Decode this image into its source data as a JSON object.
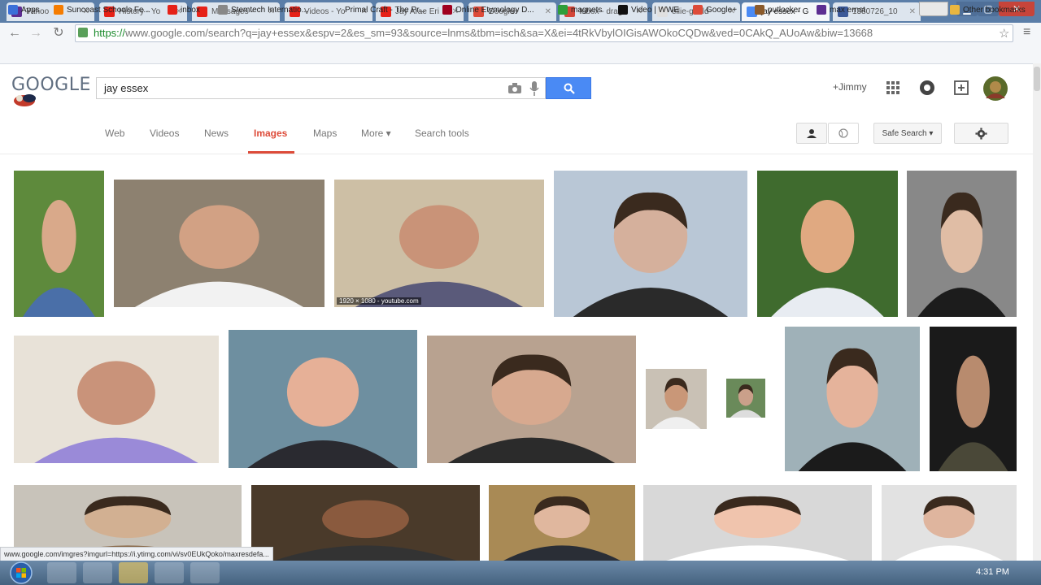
{
  "browser": {
    "tabs": [
      {
        "title": "Yahoo",
        "active": false,
        "icon": "yahoo-icon",
        "color": "#5c2d91"
      },
      {
        "title": "History - Yo",
        "active": false,
        "icon": "youtube-icon",
        "color": "#e62117"
      },
      {
        "title": "Messages -",
        "active": false,
        "icon": "youtube-icon",
        "color": "#e62117"
      },
      {
        "title": "Videos - Yo",
        "active": false,
        "icon": "youtube-icon",
        "color": "#e62117"
      },
      {
        "title": "Jay Arae Eri",
        "active": false,
        "icon": "youtube-icon",
        "color": "#e62117"
      },
      {
        "title": "Google+",
        "active": false,
        "icon": "google-plus-icon",
        "color": "#dd4b39"
      },
      {
        "title": "Inbox - drag",
        "active": false,
        "icon": "gmail-icon",
        "color": "#d44638"
      },
      {
        "title": "ellie-gould",
        "active": false,
        "icon": "document-icon",
        "color": "#e0e0e0"
      },
      {
        "title": "jay essex - G",
        "active": true,
        "icon": "google-icon",
        "color": "#4a8af4"
      },
      {
        "title": "1380726_10",
        "active": false,
        "icon": "facebook-icon",
        "color": "#3b5998"
      }
    ],
    "url_scheme": "https://",
    "url_rest": "www.google.com/search?q=jay+essex&espv=2&es_sm=93&source=lnms&tbm=isch&sa=X&ei=4tRkVbylOIGisAWOkoCQDw&ved=0CAkQ_AUoAw&biw=13668"
  },
  "bookmarks": [
    {
      "label": "Apps",
      "color": "#3a6fd8"
    },
    {
      "label": "Suncoast Schools Fe...",
      "color": "#f57c00"
    },
    {
      "label": "inbox",
      "color": "#e62117"
    },
    {
      "label": "Stemtech Internatio...",
      "color": "#888888"
    },
    {
      "label": "Primal Craft - The Pr...",
      "color": ""
    },
    {
      "label": "Online Etymology D...",
      "color": "#a0001e"
    },
    {
      "label": "magnets",
      "color": "#2e9e3a"
    },
    {
      "label": "Video | WWE",
      "color": "#111111"
    },
    {
      "label": "Google+",
      "color": "#dd4b39"
    },
    {
      "label": "putlocker",
      "color": "#8b5a2b"
    },
    {
      "label": "max ernst",
      "color": "#5c2d91"
    },
    {
      "label": "Other bookmarks",
      "color": "#e8b640"
    }
  ],
  "google": {
    "logo": "GOOGLE",
    "query": "jay essex",
    "user": "+Jimmy",
    "nav": [
      "Web",
      "Videos",
      "News",
      "Images",
      "Maps",
      "More ▾",
      "Search tools"
    ],
    "active_nav": "Images",
    "safesearch": "Safe Search ▾"
  },
  "results": [
    {
      "bg": "#5e8a3c",
      "skin": "#d9a98a",
      "shirt": "#4a6fa8",
      "bald": true
    },
    {
      "bg": "#8d8170",
      "skin": "#d2a184",
      "shirt": "#f2f2f2",
      "bald": true
    },
    {
      "bg": "#cdbfa5",
      "skin": "#c99378",
      "shirt": "#5a5a7a",
      "bald": true,
      "badge": "1920 × 1080 - youtube.com"
    },
    {
      "bg": "#b9c7d6",
      "skin": "#d5b09c",
      "shirt": "#2a2a2a",
      "bald": false
    },
    {
      "bg": "#3f6b2e",
      "skin": "#e0a981",
      "shirt": "#e8ecf2",
      "bald": true
    },
    {
      "bg": "#888888",
      "skin": "#e0bda5",
      "shirt": "#1c1c1c",
      "bald": false
    },
    {
      "bg": "#e8e2d8",
      "skin": "#c9937a",
      "shirt": "#9a8ad8",
      "bald": true
    },
    {
      "bg": "#6e8fa0",
      "skin": "#e6b097",
      "shirt": "#2a2a30",
      "bald": true
    },
    {
      "bg": "#b8a290",
      "skin": "#d7a98f",
      "shirt": "#2b2b2b",
      "bald": false
    },
    {
      "bg": "#c9c1b5",
      "skin": "#c99778",
      "shirt": "#efefef",
      "bald": false
    },
    {
      "bg": "#6a8a5a",
      "skin": "#caa08a",
      "shirt": "#ddd",
      "bald": false
    },
    {
      "bg": "#9fb1b8",
      "skin": "#e5b39b",
      "shirt": "#1b1b1b",
      "bald": false
    },
    {
      "bg": "#1a1a1a",
      "skin": "#b88b6e",
      "shirt": "#4a4838",
      "bald": true
    },
    {
      "bg": "#c8c3ba",
      "skin": "#d2b092",
      "shirt": "#8a6a4a",
      "bald": false
    },
    {
      "bg": "#4a3a2a",
      "skin": "#8a5a3e",
      "shirt": "#333",
      "bald": true
    },
    {
      "bg": "#a98a55",
      "skin": "#e0b79e",
      "shirt": "#2a2e36",
      "bald": false
    },
    {
      "bg": "#d8d8d8",
      "skin": "#f0c4ad",
      "shirt": "#fff",
      "bald": false
    },
    {
      "bg": "#e2e2e2",
      "skin": "#dfb59e",
      "shirt": "#ffffff",
      "bald": false
    }
  ],
  "status_url": "www.google.com/imgres?imgurl=https://i.ytimg.com/vi/sv0EUkQoko/maxresdefa...",
  "clock": "4:31 PM"
}
